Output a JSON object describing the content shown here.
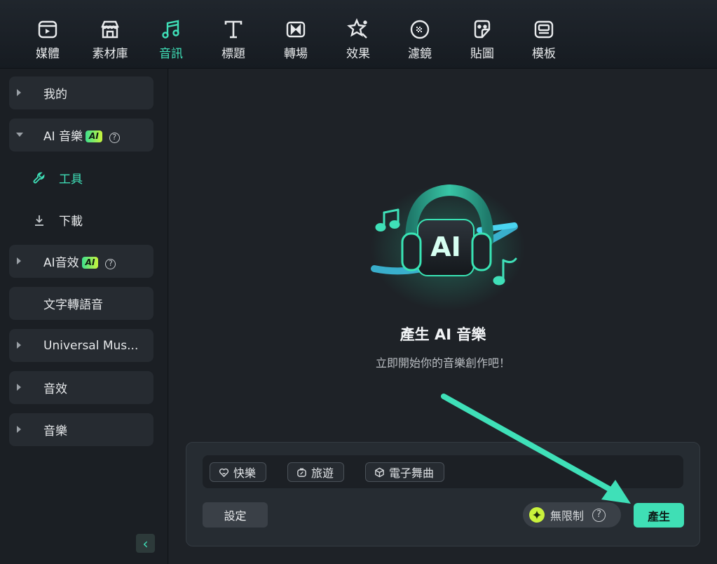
{
  "tabs": [
    {
      "label": "媒體",
      "icon": "media-icon",
      "active": false
    },
    {
      "label": "素材庫",
      "icon": "store-icon",
      "active": false
    },
    {
      "label": "音訊",
      "icon": "music-note-icon",
      "active": true
    },
    {
      "label": "標題",
      "icon": "title-t-icon",
      "active": false
    },
    {
      "label": "轉場",
      "icon": "transition-icon",
      "active": false
    },
    {
      "label": "效果",
      "icon": "effects-star-icon",
      "active": false
    },
    {
      "label": "濾鏡",
      "icon": "filter-icon",
      "active": false
    },
    {
      "label": "貼圖",
      "icon": "sticker-icon",
      "active": false
    },
    {
      "label": "模板",
      "icon": "template-icon",
      "active": false
    }
  ],
  "sidebar": {
    "my": "我的",
    "ai_music": "AI 音樂",
    "ai_badge": "AI",
    "help_glyph": "?",
    "tools": "工具",
    "download": "下載",
    "ai_sfx": "AI音效",
    "tts": "文字轉語音",
    "universal": "Universal Mus...",
    "sfx": "音效",
    "music": "音樂",
    "collapse_glyph": "‹"
  },
  "main": {
    "illustration_text": "AI",
    "title": "產生 AI 音樂",
    "subtitle": "立即開始你的音樂創作吧！",
    "chips": [
      "快樂",
      "旅遊",
      "電子舞曲"
    ],
    "settings_label": "設定",
    "unlimited_label": "無限制",
    "generate_label": "產生"
  },
  "colors": {
    "accent": "#3fdfb5",
    "badge_green": "#c8f53c"
  }
}
